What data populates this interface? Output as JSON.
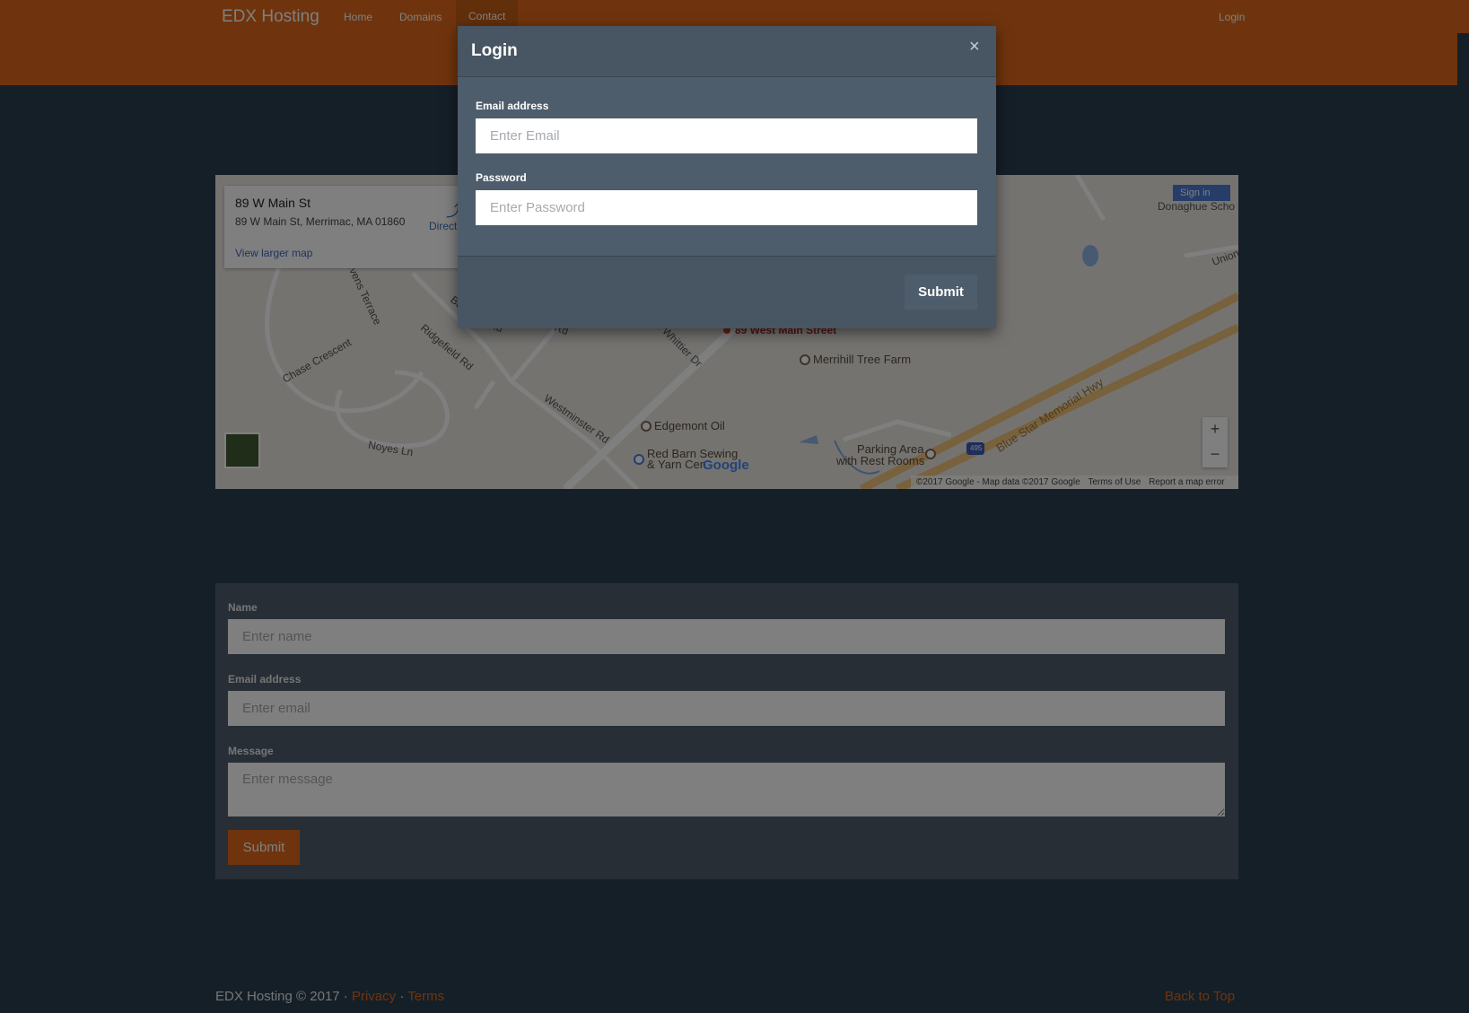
{
  "navbar": {
    "brand": "EDX Hosting",
    "links": [
      "Home",
      "Domains",
      "Contact"
    ],
    "login": "Login"
  },
  "map": {
    "place_title": "89 W Main St",
    "place_address": "89 W Main St, Merrimac, MA 01860",
    "directions": "Directions",
    "view_larger": "View larger map",
    "sign_in": "Sign in",
    "labels": {
      "donaghue": "Donaghue Scho",
      "union": "Union",
      "stevens": "Stevens Terrace",
      "chase": "Chase Crescent",
      "ridgefield": "Ridgefield Rd",
      "westminster": "Westminster Rd",
      "whittier": "Whittier Dr",
      "noyes": "Noyes Ln",
      "bd": "Bd",
      "rd1": "Rd",
      "rd2": "Rd",
      "main_street": "89 West Main Street",
      "merrihill": "Merrihill Tree Farm",
      "edgemont": "Edgemont Oil",
      "redbarn1": "Red Barn Sewing",
      "redbarn2": "& Yarn Cen",
      "parking1": "Parking Area",
      "parking2": "with Rest Rooms",
      "bluestar": "Blue Star Memorial Hwy",
      "i495": "495"
    },
    "google": "Google",
    "copyright": "©2017 Google - Map data ©2017 Google",
    "terms": "Terms of Use",
    "report": "Report a map error",
    "zoom_in": "+",
    "zoom_out": "−"
  },
  "contact_form": {
    "name_label": "Name",
    "name_placeholder": "Enter name",
    "email_label": "Email address",
    "email_placeholder": "Enter email",
    "message_label": "Message",
    "message_placeholder": "Enter message",
    "submit": "Submit"
  },
  "footer": {
    "copyright": "EDX Hosting © 2017 ·",
    "privacy": "Privacy",
    "sep": "·",
    "terms": "Terms",
    "back_to_top": "Back to Top"
  },
  "login_modal": {
    "title": "Login",
    "close": "×",
    "email_label": "Email address",
    "email_placeholder": "Enter Email",
    "password_label": "Password",
    "password_placeholder": "Enter Password",
    "submit": "Submit"
  },
  "colors": {
    "accent": "#df691a",
    "background": "#2b3e50",
    "panel": "#4e5d6c"
  }
}
